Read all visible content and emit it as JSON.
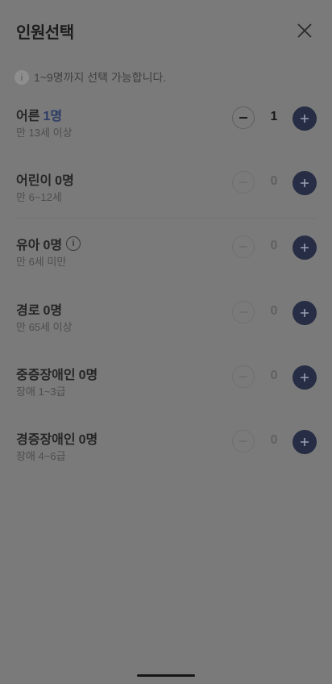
{
  "header": {
    "title": "인원선택",
    "close_icon": "close-icon"
  },
  "notice": {
    "icon": "info-icon",
    "text": "1~9명까지 선택 가능합니다."
  },
  "passengers": [
    {
      "name": "어른",
      "count_label": "1명",
      "sub": "만 13세 이상",
      "value": "1",
      "minus_enabled": true,
      "has_info": false
    },
    {
      "name": "어린이",
      "count_label": "0명",
      "sub": "만 6~12세",
      "value": "0",
      "minus_enabled": false,
      "has_info": false
    },
    {
      "name": "유아",
      "count_label": "0명",
      "sub": "만 6세 미만",
      "value": "0",
      "minus_enabled": false,
      "has_info": true,
      "info_glyph": "i"
    },
    {
      "name": "경로",
      "count_label": "0명",
      "sub": "만 65세 이상",
      "value": "0",
      "minus_enabled": false,
      "has_info": false
    },
    {
      "name": "중증장애인",
      "count_label": "0명",
      "sub": "장애 1~3급",
      "value": "0",
      "minus_enabled": false,
      "has_info": false
    },
    {
      "name": "경증장애인",
      "count_label": "0명",
      "sub": "장애 4~6급",
      "value": "0",
      "minus_enabled": false,
      "has_info": false
    }
  ],
  "colors": {
    "overlay": "#7a7a7a",
    "accent": "#262d44",
    "active_count": "#2e3c66"
  }
}
